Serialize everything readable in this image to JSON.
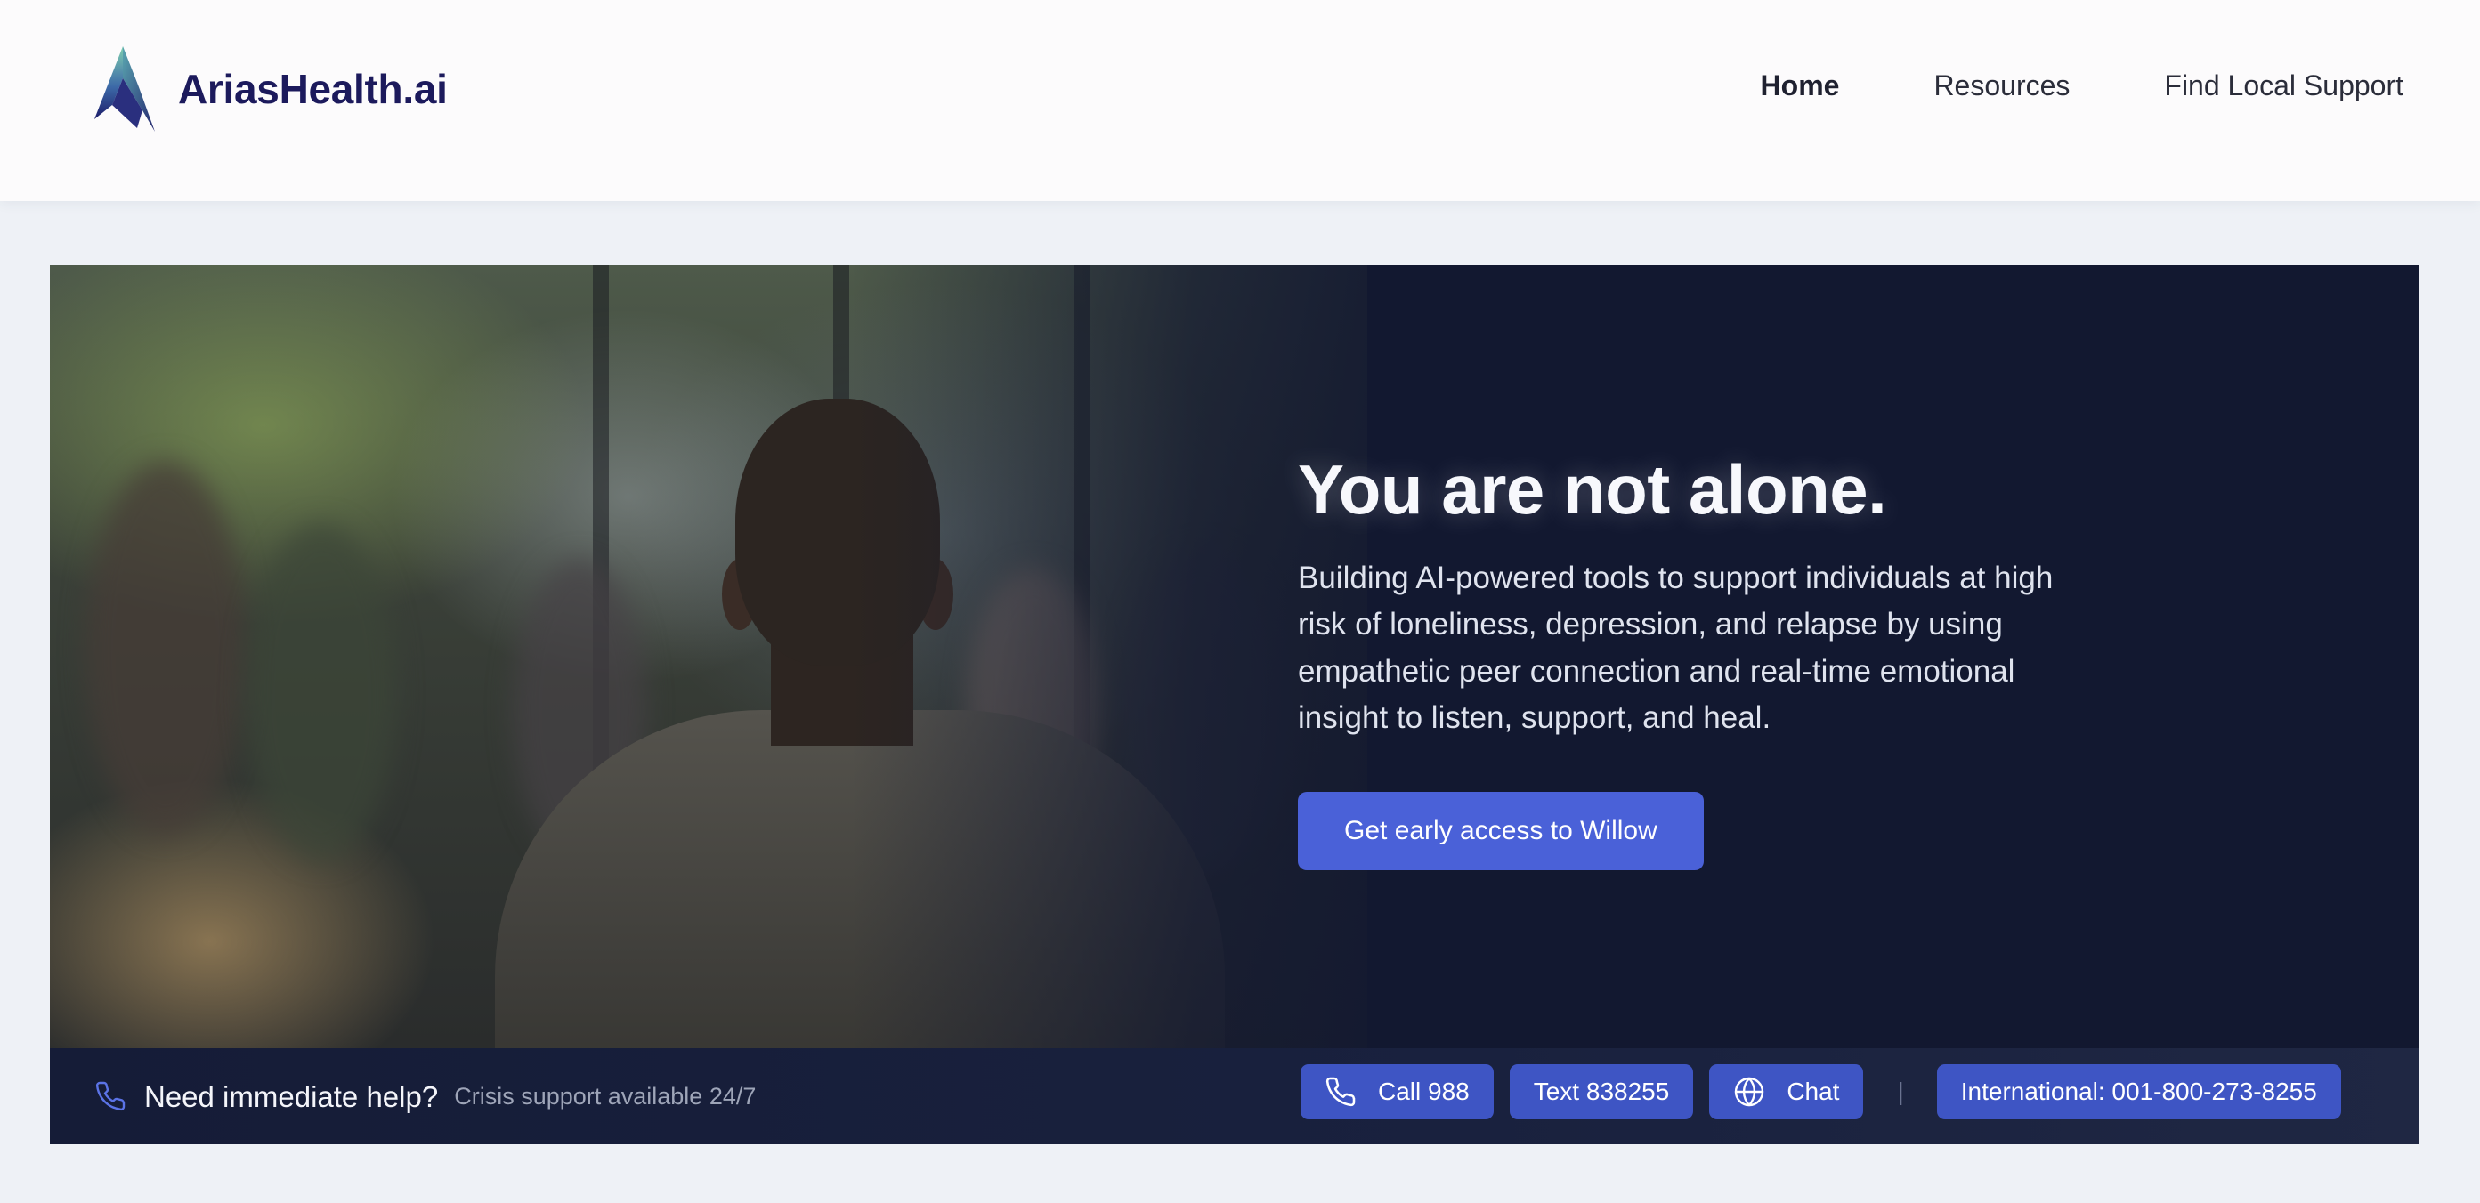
{
  "header": {
    "brand_name": "AriasHealth.ai",
    "nav": {
      "home": "Home",
      "resources": "Resources",
      "find_local_support": "Find Local Support"
    }
  },
  "hero": {
    "title": "You are not alone.",
    "subtitle": "Building AI-powered tools to support individuals at high risk of loneliness, depression, and relapse by using empathetic peer connection and real-time emotional insight to listen, support, and heal.",
    "cta_label": "Get early access to Willow"
  },
  "crisis_bar": {
    "title": "Need immediate help?",
    "subtitle": "Crisis support available 24/7",
    "call_label": "Call 988",
    "text_label": "Text 838255",
    "chat_label": "Chat",
    "divider": "|",
    "international_label": "International: 001-800-273-8255"
  },
  "icons": {
    "logo": "arias-peak-logo",
    "phone": "phone-icon",
    "globe": "globe-icon"
  },
  "colors": {
    "brand_text": "#1c1a5c",
    "accent": "#4a61d8",
    "pill": "#3e55c4",
    "hero_bg": "#121830",
    "page_bg": "#eef1f6"
  }
}
